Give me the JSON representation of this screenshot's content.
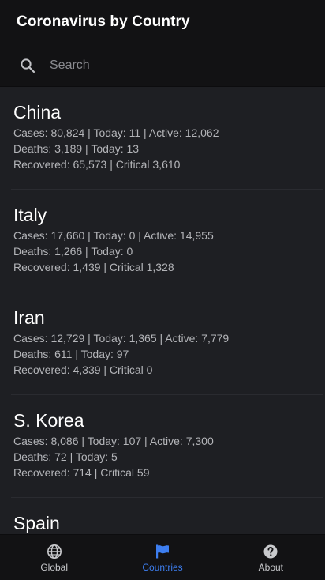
{
  "app": {
    "title": "Coronavirus by Country"
  },
  "search": {
    "placeholder": "Search",
    "value": ""
  },
  "countries": [
    {
      "name": "China",
      "line1": "Cases: 80,824 | Today: 11 | Active: 12,062",
      "line2": "Deaths: 3,189 | Today: 13",
      "line3": "Recovered: 65,573 | Critical 3,610"
    },
    {
      "name": "Italy",
      "line1": "Cases: 17,660 | Today: 0 | Active: 14,955",
      "line2": "Deaths: 1,266 | Today: 0",
      "line3": "Recovered: 1,439 | Critical 1,328"
    },
    {
      "name": "Iran",
      "line1": "Cases: 12,729 | Today: 1,365 | Active: 7,779",
      "line2": "Deaths: 611 | Today: 97",
      "line3": "Recovered: 4,339 | Critical 0"
    },
    {
      "name": "S. Korea",
      "line1": "Cases: 8,086 | Today: 107 | Active: 7,300",
      "line2": "Deaths: 72 | Today: 5",
      "line3": "Recovered: 714 | Critical 59"
    },
    {
      "name": "Spain",
      "line1": "",
      "line2": "",
      "line3": ""
    }
  ],
  "nav": {
    "items": [
      {
        "label": "Global",
        "icon": "globe-icon"
      },
      {
        "label": "Countries",
        "icon": "flag-icon",
        "active": true
      },
      {
        "label": "About",
        "icon": "help-icon"
      }
    ]
  },
  "colors": {
    "background": "#1e1f23",
    "bar": "#121214",
    "accent": "#3d7ef0",
    "text_secondary": "#b3b4b8"
  }
}
